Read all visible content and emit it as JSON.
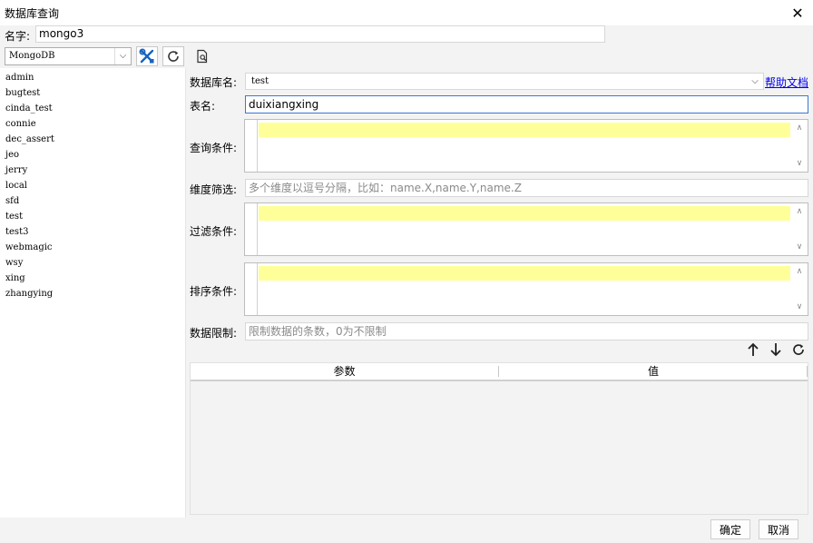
{
  "window": {
    "title": "数据库查询",
    "close": "✕"
  },
  "name_row": {
    "label": "名字:",
    "value": "mongo3"
  },
  "toolbar": {
    "datasource": "MongoDB"
  },
  "databases": [
    "admin",
    "bugtest",
    "cinda_test",
    "connie",
    "dec_assert",
    "jeo",
    "jerry",
    "local",
    "sfd",
    "test",
    "test3",
    "webmagic",
    "wsy",
    "xing",
    "zhangying"
  ],
  "form": {
    "dbname_label": "数据库名:",
    "dbname_value": "test",
    "help_link": "帮助文档",
    "tablename_label": "表名:",
    "tablename_value": "duixiangxing",
    "query_label": "查询条件:",
    "dimension_label": "维度筛选:",
    "dimension_placeholder": "多个维度以逗号分隔，比如：name.X,name.Y,name.Z",
    "filter_label": "过滤条件:",
    "sort_label": "排序条件:",
    "limit_label": "数据限制:",
    "limit_placeholder": "限制数据的条数，0为不限制"
  },
  "params": {
    "col_param": "参数",
    "col_value": "值"
  },
  "buttons": {
    "ok": "确定",
    "cancel": "取消"
  }
}
